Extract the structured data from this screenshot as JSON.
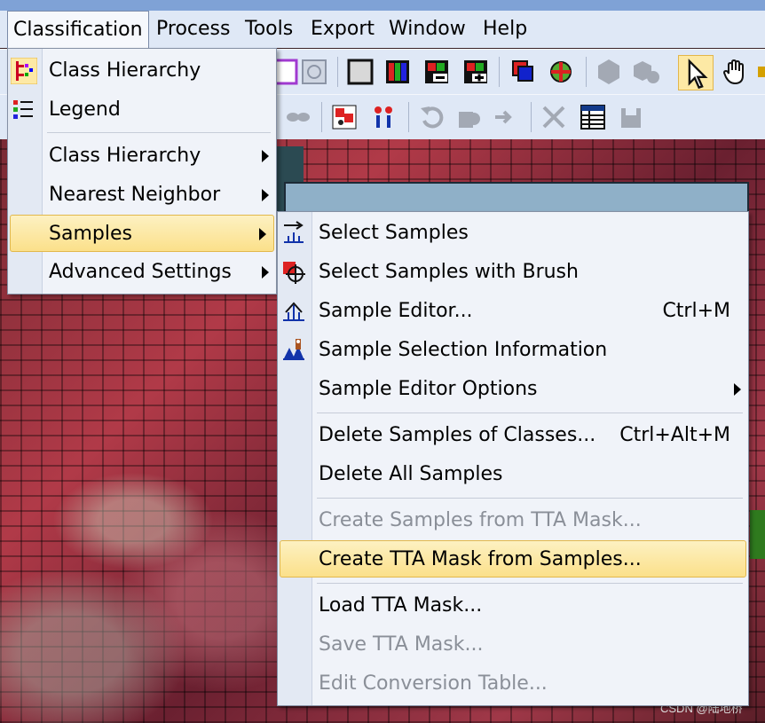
{
  "menubar": {
    "items": [
      "Classification",
      "Process",
      "Tools",
      "Export",
      "Window",
      "Help"
    ]
  },
  "classification_menu": {
    "items": [
      {
        "label": "Class Hierarchy",
        "icon": "class-hierarchy-icon"
      },
      {
        "label": "Legend",
        "icon": "legend-icon"
      },
      {
        "label": "Class Hierarchy",
        "submenu": true
      },
      {
        "label": "Nearest Neighbor",
        "submenu": true
      },
      {
        "label": "Samples",
        "submenu": true,
        "highlighted": true
      },
      {
        "label": "Advanced Settings",
        "submenu": true
      }
    ]
  },
  "samples_menu": {
    "items": [
      {
        "label": "Select Samples",
        "icon": "select-samples-icon"
      },
      {
        "label": "Select Samples with Brush",
        "icon": "brush-samples-icon"
      },
      {
        "label": "Sample Editor...",
        "shortcut": "Ctrl+M",
        "icon": "sample-editor-icon"
      },
      {
        "label": "Sample Selection Information",
        "icon": "sample-info-icon"
      },
      {
        "label": "Sample Editor Options",
        "submenu": true
      },
      {
        "label": "Delete Samples of Classes...",
        "shortcut": "Ctrl+Alt+M"
      },
      {
        "label": "Delete All Samples"
      },
      {
        "label": "Create Samples from TTA Mask...",
        "disabled": true
      },
      {
        "label": "Create TTA Mask from Samples...",
        "highlighted": true
      },
      {
        "label": "Load TTA Mask..."
      },
      {
        "label": "Save TTA Mask...",
        "disabled": true
      },
      {
        "label": "Edit Conversion Table...",
        "disabled": true
      }
    ]
  },
  "watermark": "CSDN @陆地桥",
  "colors": {
    "menu_bg": "#f0f3f9",
    "highlight": "#fbe08a",
    "menubar_bg": "#dfe8f6",
    "disabled_text": "#8a8f98"
  }
}
